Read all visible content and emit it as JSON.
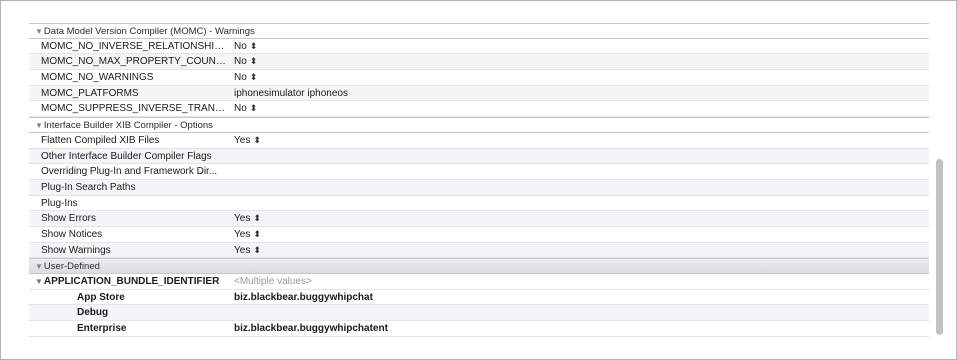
{
  "sections": [
    {
      "title": "Data Model Version Compiler (MOMC) - Warnings",
      "rows": [
        {
          "setting": "MOMC_NO_INVERSE_RELATIONSHIP_W...",
          "value": "No",
          "stepper": true
        },
        {
          "setting": "MOMC_NO_MAX_PROPERTY_COUNT_W...",
          "value": "No",
          "stepper": true
        },
        {
          "setting": "MOMC_NO_WARNINGS",
          "value": "No",
          "stepper": true
        },
        {
          "setting": "MOMC_PLATFORMS",
          "value": "iphonesimulator iphoneos",
          "stepper": false
        },
        {
          "setting": "MOMC_SUPPRESS_INVERSE_TRANSIENT...",
          "value": "No",
          "stepper": true
        }
      ]
    },
    {
      "title": "Interface Builder XIB Compiler - Options",
      "rows": [
        {
          "setting": "Flatten Compiled XIB Files",
          "value": "Yes",
          "stepper": true
        },
        {
          "setting": "Other Interface Builder Compiler Flags",
          "value": "",
          "stepper": false
        },
        {
          "setting": "Overriding Plug-In and Framework Dir...",
          "value": "",
          "stepper": false
        },
        {
          "setting": "Plug-In Search Paths",
          "value": "",
          "stepper": false
        },
        {
          "setting": "Plug-Ins",
          "value": "",
          "stepper": false
        },
        {
          "setting": "Show Errors",
          "value": "Yes",
          "stepper": true
        },
        {
          "setting": "Show Notices",
          "value": "Yes",
          "stepper": true
        },
        {
          "setting": "Show Warnings",
          "value": "Yes",
          "stepper": true
        }
      ]
    },
    {
      "title": "User-Defined",
      "defined": {
        "setting": "APPLICATION_BUNDLE_IDENTIFIER",
        "value": "<Multiple values>"
      },
      "subrows": [
        {
          "setting": "App Store",
          "value": "biz.blackbear.buggywhipchat"
        },
        {
          "setting": "Debug",
          "value": ""
        },
        {
          "setting": "Enterprise",
          "value": "biz.blackbear.buggywhipchatent"
        }
      ]
    }
  ],
  "icons": {
    "disclosure": "disclosure-triangle-icon",
    "stepper": "stepper-arrows-icon"
  },
  "colors": {
    "section_bg": "#dde1e6",
    "defined_bg": "#d5d8dc",
    "alt_row": "#f3f5f9",
    "placeholder": "#9a9a9a"
  }
}
